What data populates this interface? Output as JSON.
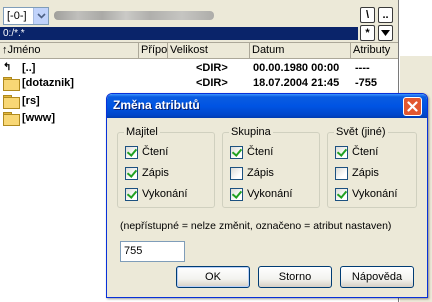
{
  "panel": {
    "drive": "[-0-]",
    "root_btn": "\\",
    "up_btn": "..",
    "filter": "0:/*.*",
    "star_btn": "*",
    "columns": [
      "↑Jméno",
      "Přípo",
      "Velikost",
      "Datum",
      "Atributy"
    ],
    "rows": [
      {
        "name": "[..]",
        "size": "<DIR>",
        "date": "00.00.1980 00:00",
        "attr": "----"
      },
      {
        "name": "[dotaznik]",
        "size": "<DIR>",
        "date": "18.07.2004 21:45",
        "attr": "-755"
      },
      {
        "name": "[rs]",
        "size": "",
        "date": "",
        "attr": ""
      },
      {
        "name": "[www]",
        "size": "",
        "date": "",
        "attr": ""
      }
    ],
    "right_number": "75"
  },
  "dialog": {
    "title": "Změna atributů",
    "groups": [
      {
        "label": "Majitel",
        "items": [
          {
            "label": "Čtení",
            "checked": true
          },
          {
            "label": "Zápis",
            "checked": true
          },
          {
            "label": "Vykonání",
            "checked": true
          }
        ]
      },
      {
        "label": "Skupina",
        "items": [
          {
            "label": "Čtení",
            "checked": true
          },
          {
            "label": "Zápis",
            "checked": false
          },
          {
            "label": "Vykonání",
            "checked": true
          }
        ]
      },
      {
        "label": "Svět (jiné)",
        "items": [
          {
            "label": "Čtení",
            "checked": true
          },
          {
            "label": "Zápis",
            "checked": false
          },
          {
            "label": "Vykonání",
            "checked": true
          }
        ]
      }
    ],
    "note": "(nepřístupné = nelze změnit, označeno = atribut nastaven)",
    "octal_value": "755",
    "ok": "OK",
    "cancel": "Storno",
    "help": "Nápověda"
  },
  "colors": {
    "title_bar": "#0054e3",
    "filter_bar": "#0a246a",
    "close_button": "#e2572f"
  }
}
